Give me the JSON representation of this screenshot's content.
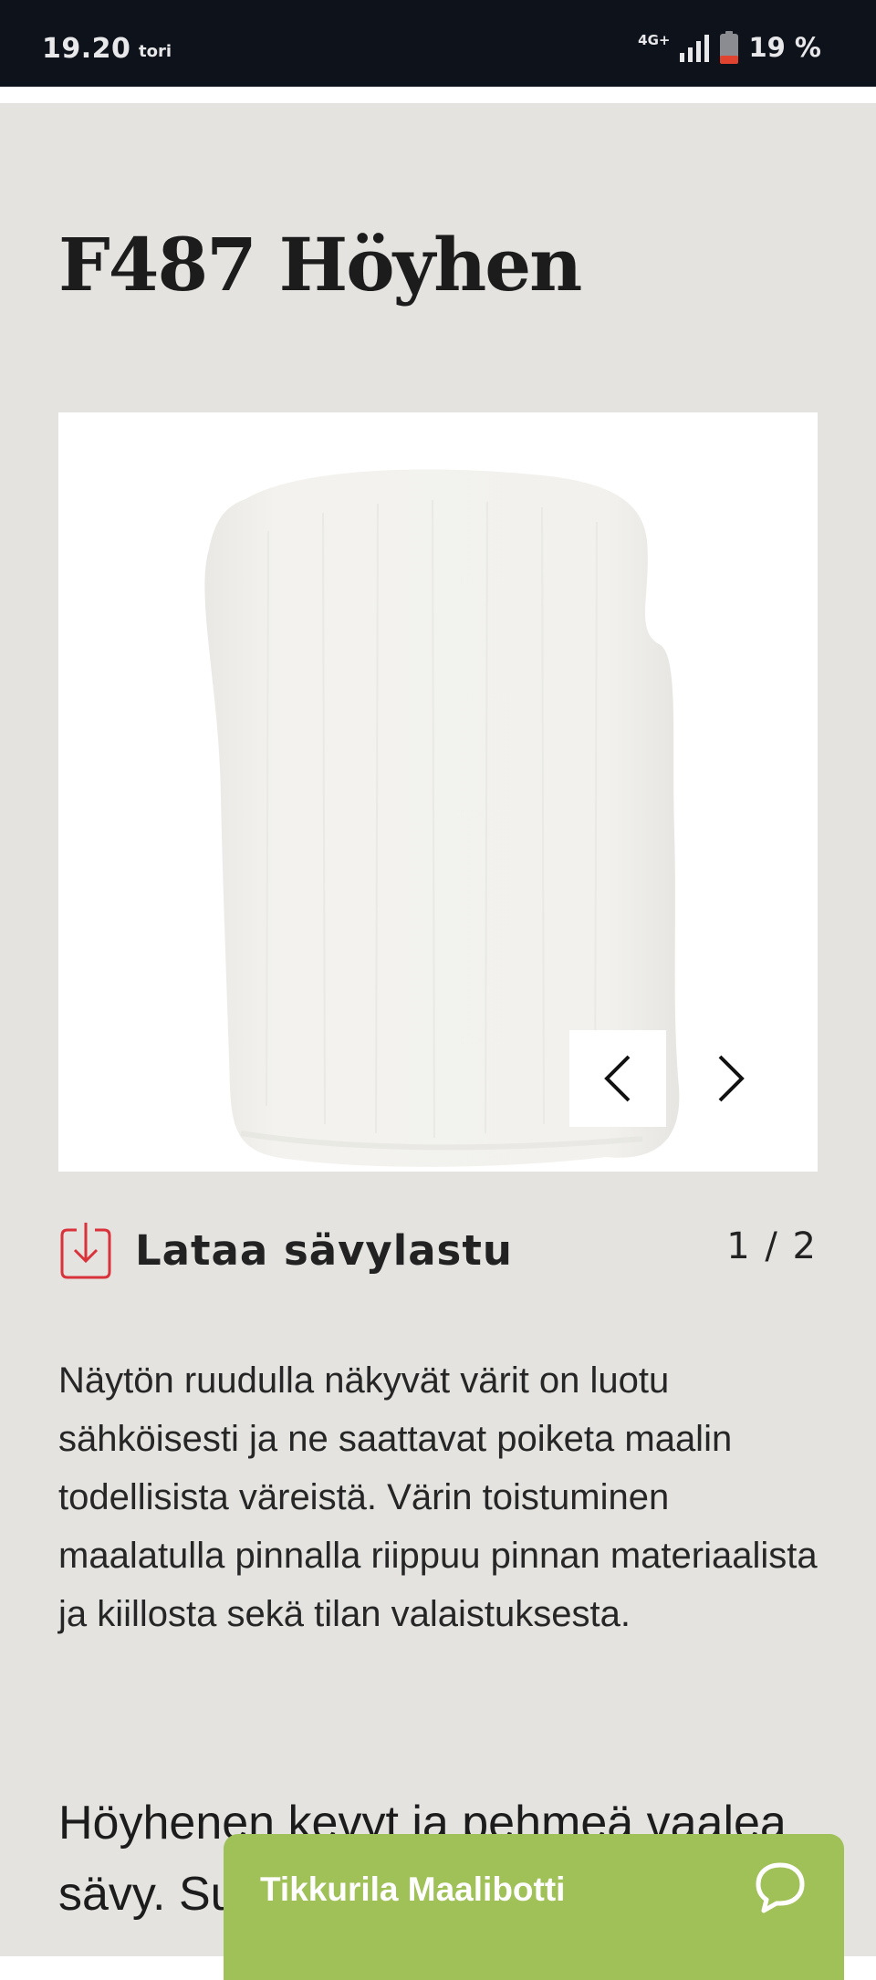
{
  "status_bar": {
    "time": "19.20",
    "app_label": "tori",
    "network": "4G+",
    "battery": "19 %"
  },
  "product": {
    "title": "F487 Höyhen",
    "swatch_color": "#f2f1ed",
    "page_indicator": "1 / 2",
    "download_label": "Lataa sävylastu",
    "disclaimer": "Näytön ruudulla näkyvät värit on luotu sähköisesti ja ne saattavat poiketa maalin todellisista väreistä. Värin toistuminen maalatulla pinnalla riippuu pinnan materiaalista ja kiillosta sekä tilan valaistuksesta.",
    "description": "Höyhenen kevyt ja pehmeä vaalea sävy. Su jossa s"
  },
  "chatbot": {
    "label": "Tikkurila Maalibotti",
    "color": "#a0c058"
  },
  "colors": {
    "page_background": "#e4e3e0",
    "status_bar": "#0e121b",
    "download_icon": "#d9323a"
  }
}
